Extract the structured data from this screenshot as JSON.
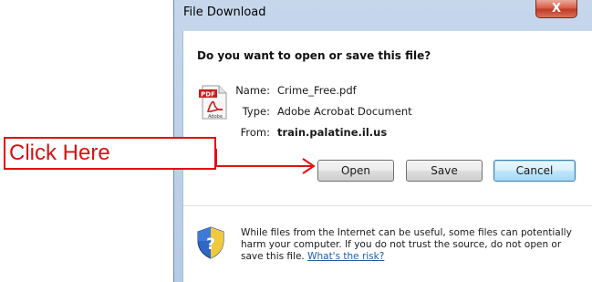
{
  "window": {
    "title": "File Download",
    "close_glyph": "X"
  },
  "dialog": {
    "question": "Do you want to open or save this file?",
    "file": {
      "name_label": "Name:",
      "name_value": "Crime_Free.pdf",
      "type_label": "Type:",
      "type_value": "Adobe Acrobat Document",
      "from_label": "From:",
      "from_value": "train.palatine.il.us"
    },
    "pdf_icon": {
      "badge_text": "PDF",
      "caption": "Adobe"
    },
    "buttons": {
      "open": "Open",
      "save": "Save",
      "cancel": "Cancel"
    },
    "warning": {
      "text": "While files from the Internet can be useful, some files can potentially harm your computer. If you do not trust the source, do not open or save this file. ",
      "link": "What's the risk?"
    }
  },
  "annotation": {
    "label": "Click Here",
    "color": "#d21515"
  },
  "icons": {
    "pdf": "pdf-file-icon",
    "shield": "security-shield-icon",
    "close": "close-icon",
    "arrow": "arrow-icon"
  }
}
